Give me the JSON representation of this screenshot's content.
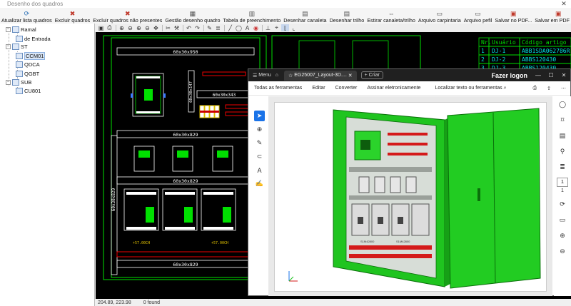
{
  "window": {
    "title": "Desenho dos quadros"
  },
  "ribbon": {
    "buttons": [
      {
        "label": "Atualizar lista quadros",
        "icon": "refresh-icon",
        "color": "#2a6fb5",
        "glyph": "⟳"
      },
      {
        "label": "Excluir quadros",
        "icon": "delete-icon",
        "color": "#c0392b",
        "glyph": "✖"
      },
      {
        "label": "Excluir quadros não presentes",
        "icon": "delete-missing-icon",
        "color": "#c0392b",
        "glyph": "✖"
      },
      {
        "label": "Gestão desenho quadro",
        "icon": "panel-design-icon",
        "color": "#555555",
        "glyph": "▦"
      },
      {
        "label": "Tabela de preenchimento",
        "icon": "table-icon",
        "color": "#555555",
        "glyph": "▥"
      },
      {
        "label": "Desenhar canaleta",
        "icon": "duct-icon",
        "color": "#555555",
        "glyph": "▤"
      },
      {
        "label": "Desenhar trilho",
        "icon": "rail-icon",
        "color": "#555555",
        "glyph": "▤"
      },
      {
        "label": "Estirar canaleta/trilho",
        "icon": "stretch-icon",
        "color": "#555555",
        "glyph": "⇔"
      },
      {
        "label": "Arquivo carpintaria",
        "icon": "carpentry-file-icon",
        "color": "#555555",
        "glyph": "▭"
      },
      {
        "label": "Arquivo pefil",
        "icon": "profile-file-icon",
        "color": "#555555",
        "glyph": "▭"
      },
      {
        "label": "Salvar no PDF...",
        "icon": "pdf-icon",
        "color": "#c0392b",
        "glyph": "▣"
      },
      {
        "label": "Salvar em PDF 3D...",
        "icon": "pdf3d-icon",
        "color": "#c0392b",
        "glyph": "▣"
      }
    ]
  },
  "tree": {
    "nodes": [
      {
        "label": "Ramal",
        "exp": "−",
        "level": 0
      },
      {
        "label": "de Entrada",
        "exp": "",
        "level": 1
      },
      {
        "label": "ST",
        "exp": "−",
        "level": 0
      },
      {
        "label": "CCM01",
        "exp": "",
        "level": 1,
        "selected": true
      },
      {
        "label": "QDCA",
        "exp": "",
        "level": 1
      },
      {
        "label": "QGBT",
        "exp": "",
        "level": 1
      },
      {
        "label": "SUB",
        "exp": "−",
        "level": 0
      },
      {
        "label": "CU801",
        "exp": "",
        "level": 1
      }
    ]
  },
  "drawing": {
    "labels": {
      "top_duct": "60x30x950",
      "mid_duct": "60x30x343",
      "vert_duct": "60x30x147",
      "row1_duct": "60x30x829",
      "row2_duct": "60x30x829",
      "left_vert": "60x30x829",
      "bottom_duct": "60x30x829"
    },
    "component_tags": [
      "1",
      "2",
      "3",
      "4",
      "5",
      "6"
    ],
    "bus_labels": [
      "+57.00CH",
      "+57.00CH"
    ]
  },
  "bom_table": {
    "headers": [
      "Nr.",
      "Usuário",
      "Código artigo"
    ],
    "rows": [
      [
        "1",
        "DJ-1",
        "ABB1SDA062786R"
      ],
      [
        "2",
        "DJ-2",
        "ABBS120430"
      ],
      [
        "3",
        "DJ-3",
        "ABBS120430"
      ]
    ]
  },
  "status": {
    "coords": "204.89, 223.98",
    "found": "0 found"
  },
  "pdf_viewer": {
    "menu_label": "Menu",
    "tab_title": "EG25007_Layout-3D....",
    "new_tab": "Criar",
    "login": "Fazer logon",
    "menus": [
      "Todas as ferramentas",
      "Editar",
      "Converter",
      "Assinar eletronicamente"
    ],
    "search": "Localizar texto ou ferramentas",
    "page_number": "1",
    "page_total": "1",
    "model_labels": [
      "S1M42800",
      "S1M42800"
    ]
  }
}
